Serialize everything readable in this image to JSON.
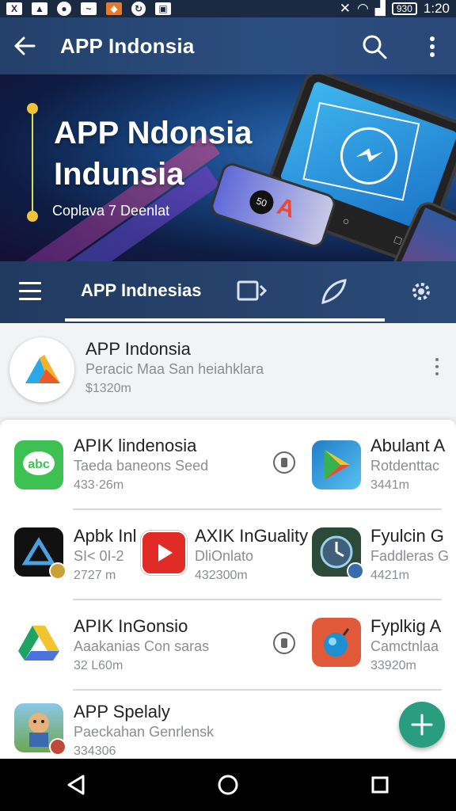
{
  "status_bar": {
    "time": "1:20",
    "battery": "930",
    "icons": [
      "x-icon",
      "image-icon",
      "record-icon",
      "photo-icon",
      "fox-icon",
      "sync-icon",
      "shopping-icon",
      "mute-icon",
      "wifi-icon",
      "signal-icon",
      "battery-icon"
    ]
  },
  "app_bar": {
    "title": "APP Indonsia",
    "icons": [
      "back-arrow-icon",
      "search-icon",
      "more-vert-icon"
    ]
  },
  "banner": {
    "title": "APP Ndonsia Indunsia",
    "subtitle": "Coplava 7 Deenlat",
    "colors": {
      "accent_dot": "#f0c43a",
      "line": "#d8e05a"
    }
  },
  "tabs": {
    "active_label": "APP Indnesias",
    "icons": [
      "menu-icon",
      "video-tab-icon",
      "leaf-tab-icon",
      "settings-tab-icon"
    ]
  },
  "featured": {
    "name": "APP Indonsia",
    "description": "Peracic Maa San heiahklara",
    "size": "$1320m"
  },
  "apps": [
    {
      "name": "APIK lindenosia",
      "desc": "Taeda baneons Seed",
      "size": "433·26m",
      "icon": "chat-abc-icon",
      "color": "#3cc152"
    },
    {
      "name": "Abulant A",
      "desc": "Rotdenttac",
      "size": "3441m",
      "icon": "play-store-icon",
      "color": "#1f7ec9"
    },
    {
      "name": "Apbk Inl",
      "desc": "SI< 0I-2",
      "size": "2727 m",
      "icon": "delta-logo-icon",
      "color": "#111111"
    },
    {
      "name": "AXIK InGuality",
      "desc": "DliOnlato",
      "size": "432300m",
      "icon": "youtube-play-icon",
      "color": "#e02b27"
    },
    {
      "name": "Fyulcin G",
      "desc": "Faddleras G",
      "size": "4421m",
      "icon": "clock-icon",
      "color": "#2c4a3a"
    },
    {
      "name": "APIK InGonsio",
      "desc": "Aaakanias Con saras",
      "size": "32 L60m",
      "icon": "drive-icon",
      "color": "#ffffff"
    },
    {
      "name": "Fyplkig A",
      "desc": "Camctnlaa",
      "size": "33920m",
      "icon": "bomb-game-icon",
      "color": "#e05a3a"
    },
    {
      "name": "APP Spelaly",
      "desc": "Paeckahan Genrlensk",
      "size": "334306",
      "icon": "cartoon-character-icon",
      "color": "#6aa84f"
    }
  ],
  "fab_color": "#2a9d80",
  "nav_icons": [
    "nav-back-icon",
    "nav-home-icon",
    "nav-recents-icon"
  ]
}
